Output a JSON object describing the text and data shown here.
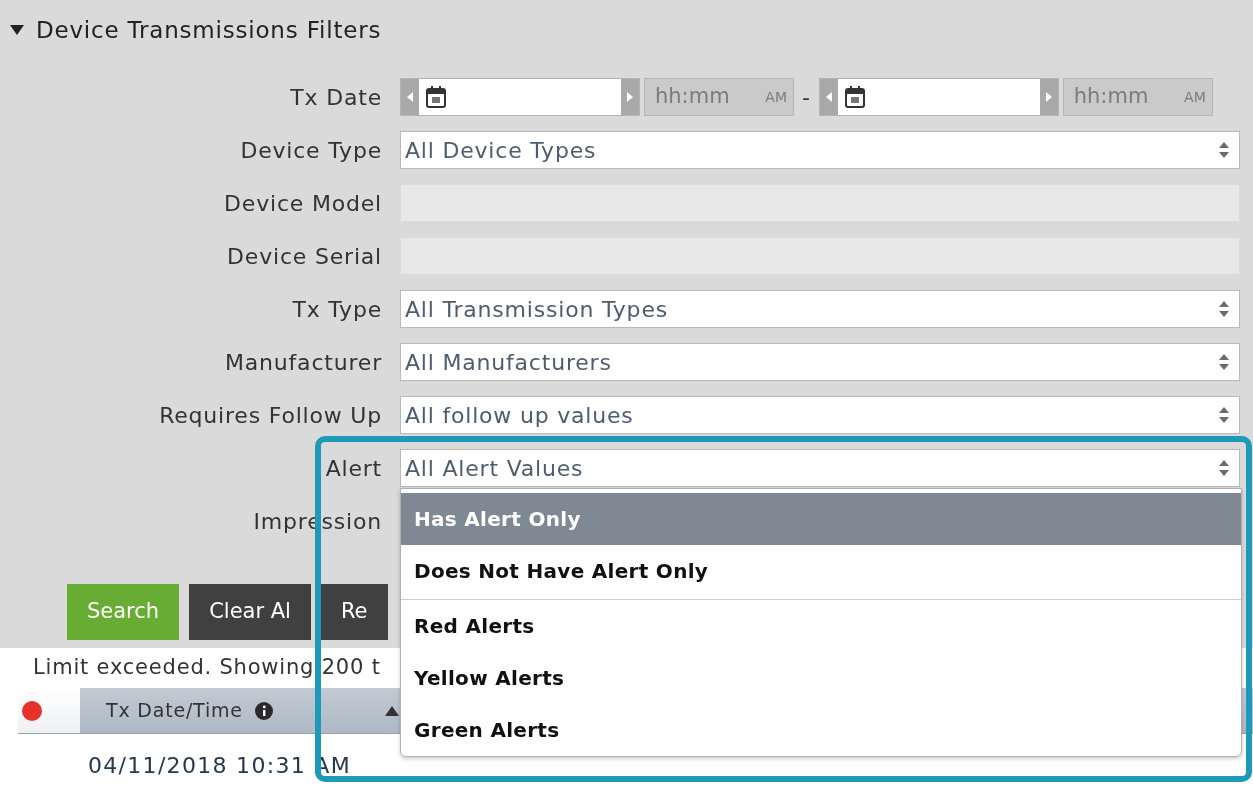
{
  "section": {
    "title": "Device Transmissions Filters",
    "expanded": true
  },
  "filters": [
    {
      "label": "Tx Date",
      "kind": "daterange",
      "separator": "-",
      "from": {
        "time_placeholder": "hh:mm",
        "ampm": "AM"
      },
      "to": {
        "time_placeholder": "hh:mm",
        "ampm": "AM"
      }
    },
    {
      "label": "Device Type",
      "kind": "select",
      "value": "All Device Types"
    },
    {
      "label": "Device Model",
      "kind": "text",
      "disabled": true
    },
    {
      "label": "Device Serial",
      "kind": "text",
      "disabled": true
    },
    {
      "label": "Tx Type",
      "kind": "select",
      "value": "All Transmission Types"
    },
    {
      "label": "Manufacturer",
      "kind": "select",
      "value": "All Manufacturers"
    },
    {
      "label": "Requires Follow Up",
      "kind": "select",
      "value": "All follow up values"
    },
    {
      "label": "Alert",
      "kind": "select",
      "value": "All Alert Values",
      "highlighted": true,
      "expanded": true,
      "option_groups": [
        [
          {
            "label": "Has Alert Only",
            "selected": true
          },
          {
            "label": "Does Not Have Alert Only",
            "selected": false
          }
        ],
        [
          {
            "label": "Red Alerts",
            "selected": false
          },
          {
            "label": "Yellow Alerts",
            "selected": false
          },
          {
            "label": "Green Alerts",
            "selected": false
          }
        ]
      ]
    },
    {
      "label": "Impression",
      "kind": "covered"
    }
  ],
  "buttons": [
    {
      "label": "Search",
      "kind": "primary"
    },
    {
      "label": "Clear Al",
      "kind": "dark"
    },
    {
      "label": "Re",
      "kind": "dark"
    }
  ],
  "notice": "Limit exceeded. Showing 200 t",
  "table": {
    "columns": [
      {
        "kind": "alert",
        "color": "#e5322a"
      },
      {
        "kind": "text",
        "label": "Tx Date/Time",
        "info": true,
        "sort_ascending": true
      }
    ],
    "rows": [
      [
        "04/11/2018 10:31 AM"
      ]
    ]
  }
}
